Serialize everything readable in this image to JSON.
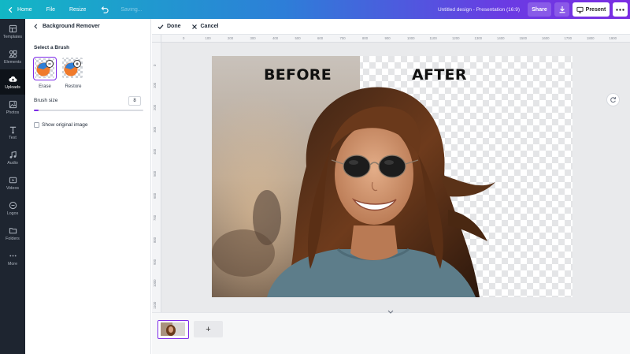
{
  "topbar": {
    "home": "Home",
    "file": "File",
    "resize": "Resize",
    "save_status": "Saving...",
    "doc_title": "Untitled design - Presentation (16:9)",
    "share": "Share",
    "present": "Present"
  },
  "rail": {
    "items": [
      {
        "label": "Templates",
        "icon": "templates-icon"
      },
      {
        "label": "Elements",
        "icon": "elements-icon"
      },
      {
        "label": "Uploads",
        "icon": "uploads-icon"
      },
      {
        "label": "Photos",
        "icon": "photos-icon"
      },
      {
        "label": "Text",
        "icon": "text-icon"
      },
      {
        "label": "Audio",
        "icon": "audio-icon"
      },
      {
        "label": "Videos",
        "icon": "videos-icon"
      },
      {
        "label": "Logos",
        "icon": "logos-icon"
      },
      {
        "label": "Folders",
        "icon": "folders-icon"
      },
      {
        "label": "More",
        "icon": "more-icon"
      }
    ],
    "active": "Uploads"
  },
  "panel": {
    "title": "Background Remover",
    "subtitle": "Select a Brush",
    "brushes": [
      {
        "label": "Erase",
        "selected": true
      },
      {
        "label": "Restore",
        "selected": false
      }
    ],
    "size_label": "Brush size",
    "size_value": "8",
    "size_fraction": 0.04,
    "show_original": "Show original image"
  },
  "toolbar": {
    "done": "Done",
    "cancel": "Cancel"
  },
  "ruler": {
    "top": [
      "0",
      "100",
      "200",
      "300",
      "400",
      "500",
      "600",
      "700",
      "800",
      "900",
      "1000",
      "1100",
      "1200",
      "1300",
      "1400",
      "1500",
      "1600",
      "1700",
      "1800",
      "1900"
    ],
    "left": [
      "0",
      "100",
      "200",
      "300",
      "400",
      "500",
      "600",
      "700",
      "800",
      "900",
      "1000",
      "1100"
    ]
  },
  "canvas": {
    "before_label": "BEFORE",
    "after_label": "AFTER"
  },
  "colors": {
    "accent": "#7d2ae8"
  }
}
